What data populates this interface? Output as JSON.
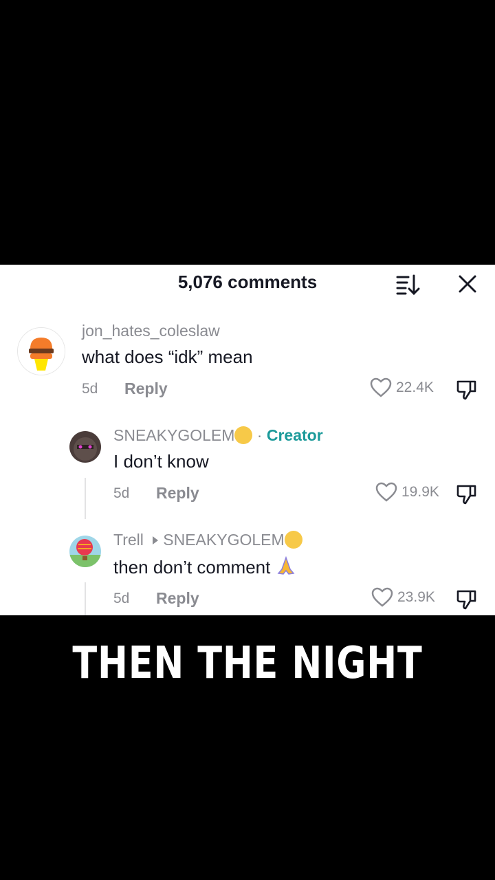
{
  "header": {
    "title": "5,076 comments",
    "sort_icon": "sort-icon",
    "close_icon": "close-icon"
  },
  "comments": [
    {
      "username": "jon_hates_coleslaw",
      "text": "what does “idk” mean",
      "age": "5d",
      "reply_label": "Reply",
      "likes": "22.4K"
    },
    {
      "username": "SNEAKYGOLEM",
      "badge": "Creator",
      "separator": "·",
      "text": "I don’t know",
      "age": "5d",
      "reply_label": "Reply",
      "likes": "19.9K"
    },
    {
      "username": "Trell",
      "reply_to": "SNEAKYGOLEM",
      "text": "then don’t comment",
      "age": "5d",
      "reply_label": "Reply",
      "likes": "23.9K"
    }
  ],
  "caption": "THEN THE NIGHT",
  "colors": {
    "creator_badge": "#1b9a9a",
    "secondary_text": "#8a8b91",
    "primary_text": "#161823"
  }
}
